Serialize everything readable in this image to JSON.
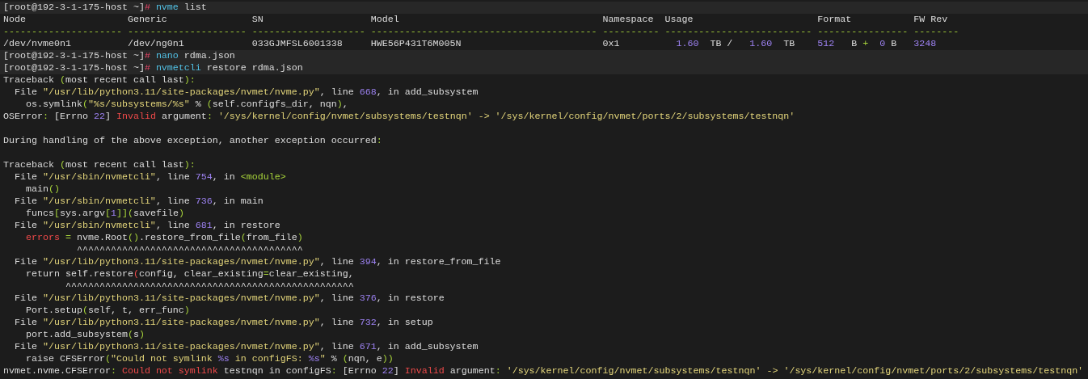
{
  "terminal": {
    "lines": [
      {
        "kind": "prompt",
        "segments": [
          {
            "kind": "plain",
            "text": "[root@192-3-1-175-host ~]"
          },
          {
            "kind": "hash",
            "text": "# "
          },
          {
            "kind": "cmd",
            "text": "nvme"
          },
          {
            "kind": "plain",
            "text": " list"
          }
        ]
      },
      {
        "kind": "output",
        "segments": [
          {
            "kind": "plain",
            "text": "Node                  Generic               SN                   Model                                    Namespace  Usage                      Format           FW Rev"
          }
        ]
      },
      {
        "kind": "output",
        "segments": [
          {
            "kind": "rule",
            "text": "--------------------- --------------------- -------------------- ---------------------------------------- ---------- -------------------------- ---------------- --------"
          }
        ]
      },
      {
        "kind": "output",
        "segments": [
          {
            "kind": "plain",
            "text": "/dev/nvme0n1          /dev/ng0n1            033GJMFSL6001338     HWE56P431T6M005N                         0x1          "
          },
          {
            "kind": "num",
            "text": "1.60"
          },
          {
            "kind": "plain",
            "text": "  TB /   "
          },
          {
            "kind": "num",
            "text": "1.60"
          },
          {
            "kind": "plain",
            "text": "  TB    "
          },
          {
            "kind": "num",
            "text": "512"
          },
          {
            "kind": "plain",
            "text": "   B "
          },
          {
            "kind": "punct",
            "text": "+  "
          },
          {
            "kind": "num",
            "text": "0"
          },
          {
            "kind": "plain",
            "text": " B   "
          },
          {
            "kind": "num",
            "text": "3248"
          }
        ]
      },
      {
        "kind": "prompt",
        "segments": [
          {
            "kind": "plain",
            "text": "[root@192-3-1-175-host ~]"
          },
          {
            "kind": "hash",
            "text": "# "
          },
          {
            "kind": "cmd",
            "text": "nano"
          },
          {
            "kind": "plain",
            "text": " rdma.json"
          }
        ]
      },
      {
        "kind": "prompt",
        "segments": [
          {
            "kind": "plain",
            "text": "[root@192-3-1-175-host ~]"
          },
          {
            "kind": "hash",
            "text": "# "
          },
          {
            "kind": "cmd",
            "text": "nvmetcli"
          },
          {
            "kind": "plain",
            "text": " restore rdma.json"
          }
        ]
      },
      {
        "kind": "output",
        "segments": [
          {
            "kind": "plain",
            "text": "Traceback "
          },
          {
            "kind": "punct",
            "text": "("
          },
          {
            "kind": "plain",
            "text": "most recent call last"
          },
          {
            "kind": "punct",
            "text": "):"
          }
        ]
      },
      {
        "kind": "output",
        "segments": [
          {
            "kind": "plain",
            "text": "  File "
          },
          {
            "kind": "str",
            "text": "\"/usr/lib/python3.11/site-packages/nvmet/nvme.py\""
          },
          {
            "kind": "plain",
            "text": ", line "
          },
          {
            "kind": "num",
            "text": "668"
          },
          {
            "kind": "plain",
            "text": ", in add_subsystem"
          }
        ]
      },
      {
        "kind": "output",
        "segments": [
          {
            "kind": "plain",
            "text": "    os.symlink"
          },
          {
            "kind": "punct",
            "text": "("
          },
          {
            "kind": "str",
            "text": "\"%s/subsystems/%s\""
          },
          {
            "kind": "plain",
            "text": " % "
          },
          {
            "kind": "punct",
            "text": "("
          },
          {
            "kind": "plain",
            "text": "self.configfs_dir, nqn"
          },
          {
            "kind": "punct",
            "text": ")"
          },
          {
            "kind": "plain",
            "text": ","
          }
        ]
      },
      {
        "kind": "output",
        "segments": [
          {
            "kind": "plain",
            "text": "OSError"
          },
          {
            "kind": "punct",
            "text": ": "
          },
          {
            "kind": "plain",
            "text": "[Errno "
          },
          {
            "kind": "num",
            "text": "22"
          },
          {
            "kind": "plain",
            "text": "] "
          },
          {
            "kind": "err",
            "text": "Invalid"
          },
          {
            "kind": "plain",
            "text": " argument"
          },
          {
            "kind": "punct",
            "text": ": "
          },
          {
            "kind": "str",
            "text": "'/sys/kernel/config/nvmet/subsystems/testnqn' -> '/sys/kernel/config/nvmet/ports/2/subsystems/testnqn'"
          }
        ]
      },
      {
        "kind": "blank"
      },
      {
        "kind": "output",
        "segments": [
          {
            "kind": "plain",
            "text": "During handling of the above exception, another exception occurred"
          },
          {
            "kind": "punct",
            "text": ":"
          }
        ]
      },
      {
        "kind": "blank"
      },
      {
        "kind": "output",
        "segments": [
          {
            "kind": "plain",
            "text": "Traceback "
          },
          {
            "kind": "punct",
            "text": "("
          },
          {
            "kind": "plain",
            "text": "most recent call last"
          },
          {
            "kind": "punct",
            "text": "):"
          }
        ]
      },
      {
        "kind": "output",
        "segments": [
          {
            "kind": "plain",
            "text": "  File "
          },
          {
            "kind": "str",
            "text": "\"/usr/sbin/nvmetcli\""
          },
          {
            "kind": "plain",
            "text": ", line "
          },
          {
            "kind": "num",
            "text": "754"
          },
          {
            "kind": "plain",
            "text": ", in "
          },
          {
            "kind": "punct",
            "text": "<module>"
          }
        ]
      },
      {
        "kind": "output",
        "segments": [
          {
            "kind": "plain",
            "text": "    main"
          },
          {
            "kind": "punct",
            "text": "()"
          }
        ]
      },
      {
        "kind": "output",
        "segments": [
          {
            "kind": "plain",
            "text": "  File "
          },
          {
            "kind": "str",
            "text": "\"/usr/sbin/nvmetcli\""
          },
          {
            "kind": "plain",
            "text": ", line "
          },
          {
            "kind": "num",
            "text": "736"
          },
          {
            "kind": "plain",
            "text": ", in main"
          }
        ]
      },
      {
        "kind": "output",
        "segments": [
          {
            "kind": "plain",
            "text": "    funcs"
          },
          {
            "kind": "punct",
            "text": "["
          },
          {
            "kind": "plain",
            "text": "sys.argv"
          },
          {
            "kind": "punct",
            "text": "["
          },
          {
            "kind": "num",
            "text": "1"
          },
          {
            "kind": "punct",
            "text": "]]("
          },
          {
            "kind": "plain",
            "text": "savefile"
          },
          {
            "kind": "punct",
            "text": ")"
          }
        ]
      },
      {
        "kind": "output",
        "segments": [
          {
            "kind": "plain",
            "text": "  File "
          },
          {
            "kind": "str",
            "text": "\"/usr/sbin/nvmetcli\""
          },
          {
            "kind": "plain",
            "text": ", line "
          },
          {
            "kind": "num",
            "text": "681"
          },
          {
            "kind": "plain",
            "text": ", in restore"
          }
        ]
      },
      {
        "kind": "output",
        "segments": [
          {
            "kind": "err",
            "text": "    errors "
          },
          {
            "kind": "punct",
            "text": "="
          },
          {
            "kind": "plain",
            "text": " nvme.Root"
          },
          {
            "kind": "punct",
            "text": "()"
          },
          {
            "kind": "plain",
            "text": ".restore_from_file"
          },
          {
            "kind": "punct",
            "text": "("
          },
          {
            "kind": "plain",
            "text": "from_file"
          },
          {
            "kind": "punct",
            "text": ")"
          }
        ]
      },
      {
        "kind": "output",
        "segments": [
          {
            "kind": "plain",
            "text": "             ^^^^^^^^^^^^^^^^^^^^^^^^^^^^^^^^^^^^^^^^"
          }
        ]
      },
      {
        "kind": "output",
        "segments": [
          {
            "kind": "plain",
            "text": "  File "
          },
          {
            "kind": "str",
            "text": "\"/usr/lib/python3.11/site-packages/nvmet/nvme.py\""
          },
          {
            "kind": "plain",
            "text": ", line "
          },
          {
            "kind": "num",
            "text": "394"
          },
          {
            "kind": "plain",
            "text": ", in restore_from_file"
          }
        ]
      },
      {
        "kind": "output",
        "segments": [
          {
            "kind": "plain",
            "text": "    return self.restore"
          },
          {
            "kind": "err",
            "text": "("
          },
          {
            "kind": "plain",
            "text": "config, clear_existing"
          },
          {
            "kind": "punct",
            "text": "="
          },
          {
            "kind": "plain",
            "text": "clear_existing,"
          }
        ]
      },
      {
        "kind": "output",
        "segments": [
          {
            "kind": "plain",
            "text": "           ^^^^^^^^^^^^^^^^^^^^^^^^^^^^^^^^^^^^^^^^^^^^^^^^^^^"
          }
        ]
      },
      {
        "kind": "output",
        "segments": [
          {
            "kind": "plain",
            "text": "  File "
          },
          {
            "kind": "str",
            "text": "\"/usr/lib/python3.11/site-packages/nvmet/nvme.py\""
          },
          {
            "kind": "plain",
            "text": ", line "
          },
          {
            "kind": "num",
            "text": "376"
          },
          {
            "kind": "plain",
            "text": ", in restore"
          }
        ]
      },
      {
        "kind": "output",
        "segments": [
          {
            "kind": "plain",
            "text": "    Port.setup"
          },
          {
            "kind": "punct",
            "text": "("
          },
          {
            "kind": "plain",
            "text": "self, t, err_func"
          },
          {
            "kind": "punct",
            "text": ")"
          }
        ]
      },
      {
        "kind": "output",
        "segments": [
          {
            "kind": "plain",
            "text": "  File "
          },
          {
            "kind": "str",
            "text": "\"/usr/lib/python3.11/site-packages/nvmet/nvme.py\""
          },
          {
            "kind": "plain",
            "text": ", line "
          },
          {
            "kind": "num",
            "text": "732"
          },
          {
            "kind": "plain",
            "text": ", in setup"
          }
        ]
      },
      {
        "kind": "output",
        "segments": [
          {
            "kind": "plain",
            "text": "    port.add_subsystem"
          },
          {
            "kind": "punct",
            "text": "("
          },
          {
            "kind": "plain",
            "text": "s"
          },
          {
            "kind": "punct",
            "text": ")"
          }
        ]
      },
      {
        "kind": "output",
        "segments": [
          {
            "kind": "plain",
            "text": "  File "
          },
          {
            "kind": "str",
            "text": "\"/usr/lib/python3.11/site-packages/nvmet/nvme.py\""
          },
          {
            "kind": "plain",
            "text": ", line "
          },
          {
            "kind": "num",
            "text": "671"
          },
          {
            "kind": "plain",
            "text": ", in add_subsystem"
          }
        ]
      },
      {
        "kind": "output",
        "segments": [
          {
            "kind": "plain",
            "text": "    raise CFSError"
          },
          {
            "kind": "punct",
            "text": "("
          },
          {
            "kind": "str",
            "text": "\"Could not symlink "
          },
          {
            "kind": "num",
            "text": "%s"
          },
          {
            "kind": "str",
            "text": " in configFS: "
          },
          {
            "kind": "num",
            "text": "%s"
          },
          {
            "kind": "str",
            "text": "\""
          },
          {
            "kind": "plain",
            "text": " % "
          },
          {
            "kind": "punct",
            "text": "("
          },
          {
            "kind": "plain",
            "text": "nqn, e"
          },
          {
            "kind": "punct",
            "text": "))"
          }
        ]
      },
      {
        "kind": "output",
        "segments": [
          {
            "kind": "plain",
            "text": "nvmet.nvme.CFSError"
          },
          {
            "kind": "punct",
            "text": ": "
          },
          {
            "kind": "err",
            "text": "Could not symlink"
          },
          {
            "kind": "plain",
            "text": " testnqn in configFS"
          },
          {
            "kind": "punct",
            "text": ": "
          },
          {
            "kind": "plain",
            "text": "[Errno "
          },
          {
            "kind": "num",
            "text": "22"
          },
          {
            "kind": "plain",
            "text": "] "
          },
          {
            "kind": "err",
            "text": "Invalid"
          },
          {
            "kind": "plain",
            "text": " argument"
          },
          {
            "kind": "punct",
            "text": ": "
          },
          {
            "kind": "str",
            "text": "'/sys/kernel/config/nvmet/subsystems/testnqn' -> '/sys/kernel/config/nvmet/ports/2/subsystems/testnqn'"
          }
        ]
      }
    ]
  }
}
